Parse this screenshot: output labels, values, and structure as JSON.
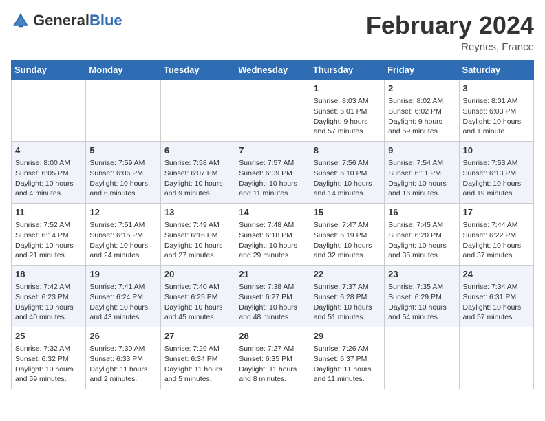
{
  "header": {
    "logo_general": "General",
    "logo_blue": "Blue",
    "title": "February 2024",
    "subtitle": "Reynes, France"
  },
  "days_of_week": [
    "Sunday",
    "Monday",
    "Tuesday",
    "Wednesday",
    "Thursday",
    "Friday",
    "Saturday"
  ],
  "weeks": [
    {
      "stripe": "alt",
      "days": [
        {
          "num": "",
          "info": ""
        },
        {
          "num": "",
          "info": ""
        },
        {
          "num": "",
          "info": ""
        },
        {
          "num": "",
          "info": ""
        },
        {
          "num": "1",
          "info": "Sunrise: 8:03 AM\nSunset: 6:01 PM\nDaylight: 9 hours\nand 57 minutes."
        },
        {
          "num": "2",
          "info": "Sunrise: 8:02 AM\nSunset: 6:02 PM\nDaylight: 9 hours\nand 59 minutes."
        },
        {
          "num": "3",
          "info": "Sunrise: 8:01 AM\nSunset: 6:03 PM\nDaylight: 10 hours\nand 1 minute."
        }
      ]
    },
    {
      "stripe": "",
      "days": [
        {
          "num": "4",
          "info": "Sunrise: 8:00 AM\nSunset: 6:05 PM\nDaylight: 10 hours\nand 4 minutes."
        },
        {
          "num": "5",
          "info": "Sunrise: 7:59 AM\nSunset: 6:06 PM\nDaylight: 10 hours\nand 6 minutes."
        },
        {
          "num": "6",
          "info": "Sunrise: 7:58 AM\nSunset: 6:07 PM\nDaylight: 10 hours\nand 9 minutes."
        },
        {
          "num": "7",
          "info": "Sunrise: 7:57 AM\nSunset: 6:09 PM\nDaylight: 10 hours\nand 11 minutes."
        },
        {
          "num": "8",
          "info": "Sunrise: 7:56 AM\nSunset: 6:10 PM\nDaylight: 10 hours\nand 14 minutes."
        },
        {
          "num": "9",
          "info": "Sunrise: 7:54 AM\nSunset: 6:11 PM\nDaylight: 10 hours\nand 16 minutes."
        },
        {
          "num": "10",
          "info": "Sunrise: 7:53 AM\nSunset: 6:13 PM\nDaylight: 10 hours\nand 19 minutes."
        }
      ]
    },
    {
      "stripe": "alt",
      "days": [
        {
          "num": "11",
          "info": "Sunrise: 7:52 AM\nSunset: 6:14 PM\nDaylight: 10 hours\nand 21 minutes."
        },
        {
          "num": "12",
          "info": "Sunrise: 7:51 AM\nSunset: 6:15 PM\nDaylight: 10 hours\nand 24 minutes."
        },
        {
          "num": "13",
          "info": "Sunrise: 7:49 AM\nSunset: 6:16 PM\nDaylight: 10 hours\nand 27 minutes."
        },
        {
          "num": "14",
          "info": "Sunrise: 7:48 AM\nSunset: 6:18 PM\nDaylight: 10 hours\nand 29 minutes."
        },
        {
          "num": "15",
          "info": "Sunrise: 7:47 AM\nSunset: 6:19 PM\nDaylight: 10 hours\nand 32 minutes."
        },
        {
          "num": "16",
          "info": "Sunrise: 7:45 AM\nSunset: 6:20 PM\nDaylight: 10 hours\nand 35 minutes."
        },
        {
          "num": "17",
          "info": "Sunrise: 7:44 AM\nSunset: 6:22 PM\nDaylight: 10 hours\nand 37 minutes."
        }
      ]
    },
    {
      "stripe": "",
      "days": [
        {
          "num": "18",
          "info": "Sunrise: 7:42 AM\nSunset: 6:23 PM\nDaylight: 10 hours\nand 40 minutes."
        },
        {
          "num": "19",
          "info": "Sunrise: 7:41 AM\nSunset: 6:24 PM\nDaylight: 10 hours\nand 43 minutes."
        },
        {
          "num": "20",
          "info": "Sunrise: 7:40 AM\nSunset: 6:25 PM\nDaylight: 10 hours\nand 45 minutes."
        },
        {
          "num": "21",
          "info": "Sunrise: 7:38 AM\nSunset: 6:27 PM\nDaylight: 10 hours\nand 48 minutes."
        },
        {
          "num": "22",
          "info": "Sunrise: 7:37 AM\nSunset: 6:28 PM\nDaylight: 10 hours\nand 51 minutes."
        },
        {
          "num": "23",
          "info": "Sunrise: 7:35 AM\nSunset: 6:29 PM\nDaylight: 10 hours\nand 54 minutes."
        },
        {
          "num": "24",
          "info": "Sunrise: 7:34 AM\nSunset: 6:31 PM\nDaylight: 10 hours\nand 57 minutes."
        }
      ]
    },
    {
      "stripe": "alt",
      "days": [
        {
          "num": "25",
          "info": "Sunrise: 7:32 AM\nSunset: 6:32 PM\nDaylight: 10 hours\nand 59 minutes."
        },
        {
          "num": "26",
          "info": "Sunrise: 7:30 AM\nSunset: 6:33 PM\nDaylight: 11 hours\nand 2 minutes."
        },
        {
          "num": "27",
          "info": "Sunrise: 7:29 AM\nSunset: 6:34 PM\nDaylight: 11 hours\nand 5 minutes."
        },
        {
          "num": "28",
          "info": "Sunrise: 7:27 AM\nSunset: 6:35 PM\nDaylight: 11 hours\nand 8 minutes."
        },
        {
          "num": "29",
          "info": "Sunrise: 7:26 AM\nSunset: 6:37 PM\nDaylight: 11 hours\nand 11 minutes."
        },
        {
          "num": "",
          "info": ""
        },
        {
          "num": "",
          "info": ""
        }
      ]
    }
  ]
}
